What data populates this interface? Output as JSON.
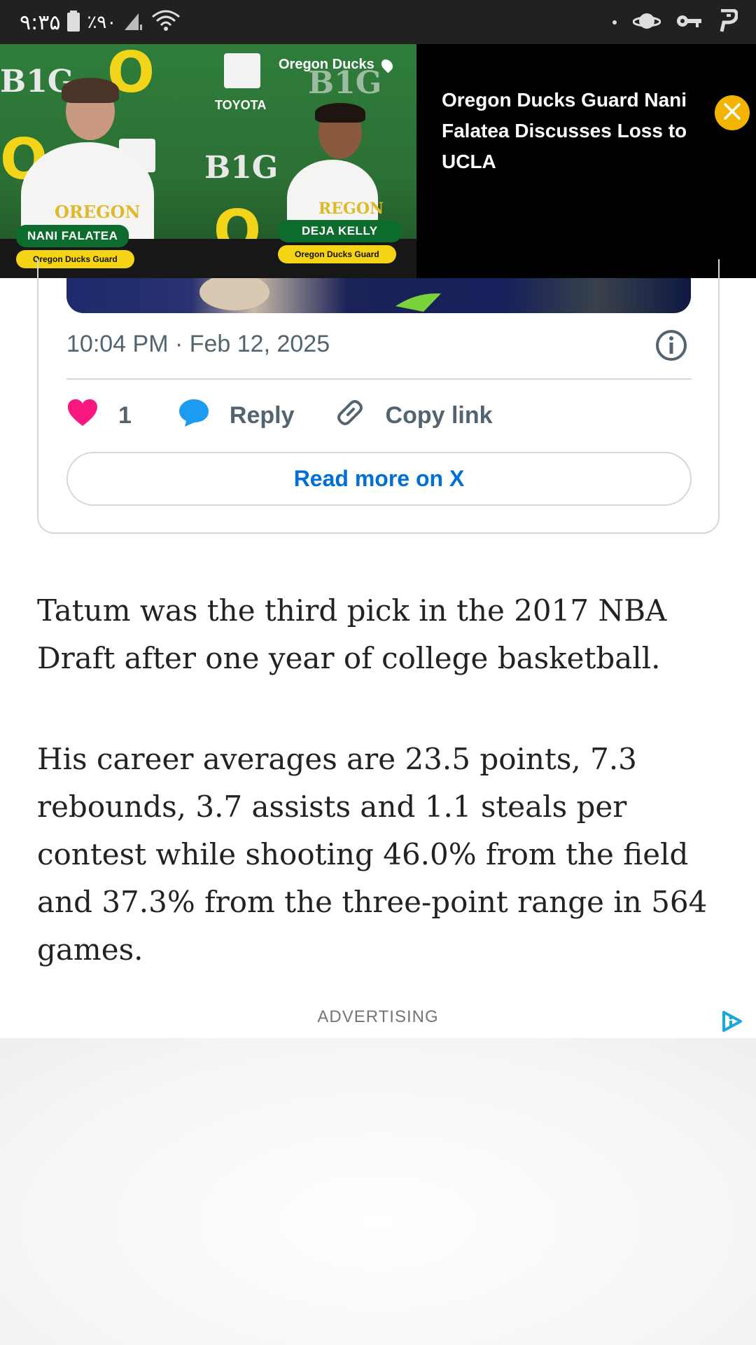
{
  "status_bar": {
    "time": "۹:۳۵",
    "battery": "٪۹۰"
  },
  "video": {
    "title": "Oregon Ducks Guard Nani Falatea Discusses Loss to UCLA",
    "channel": "Oregon Ducks",
    "player1_name": "NANI FALATEA",
    "player1_role": "Oregon Ducks Guard",
    "player2_name": "DEJA KELLY",
    "player2_role": "Oregon Ducks Guard",
    "backdrop_logo": "B1G",
    "sponsor": "TOYOTA",
    "close_icon": "close-icon"
  },
  "tweet": {
    "timestamp": "10:04 PM · Feb 12, 2025",
    "likes": "1",
    "reply_label": "Reply",
    "copy_link_label": "Copy link",
    "read_more_label": "Read more on X"
  },
  "article": {
    "paragraphs": [
      "Tatum was the third pick in the 2017 NBA Draft after one year of college basketball.",
      "His career averages are 23.5 points, 7.3 rebounds, 3.7 assists and 1.1 steals per contest while shooting 46.0% from the field and 37.3% from the three-point range in 564 games."
    ]
  },
  "ad": {
    "label": "ADVERTISING"
  },
  "colors": {
    "like": "#f91880",
    "reply": "#1d9bf0",
    "link": "#006fd6",
    "close_button": "#f3b400",
    "status_bar": "#212121"
  }
}
